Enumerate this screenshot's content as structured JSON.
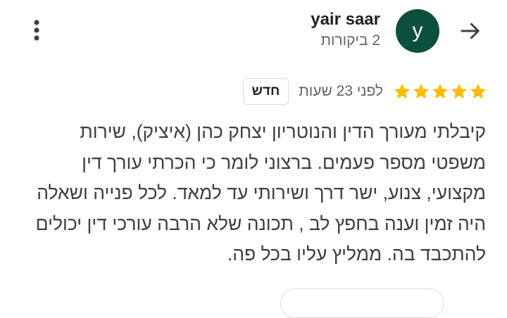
{
  "reviewer": {
    "name": "yair saar",
    "avatar_letter": "y",
    "reviews_count": "2 ביקורות"
  },
  "review": {
    "rating": 5,
    "time_ago": "לפני 23 שעות",
    "badge": "חדש",
    "text": "קיבלתי מעורך הדין והנוטריון יצחק כהן (איציק), שירות משפטי מספר פעמים. ברצוני לומר כי הכרתי עורך דין מקצועי, צנוע, ישר דרך ושירותי עד למאד. לכל פנייה ושאלה היה זמין וענה בחפץ לב , תכונה שלא הרבה עורכי דין יכולים להתכבד בה. ממליץ עליו בכל פה."
  },
  "icons": {
    "back": "arrow-forward-icon",
    "more": "more-vert-icon",
    "star": "star-icon"
  },
  "colors": {
    "avatar_bg": "#0b4f3c",
    "star": "#fbbc04",
    "secondary_text": "#5f6368",
    "body_text": "#3c4043",
    "border": "#dadce0"
  }
}
